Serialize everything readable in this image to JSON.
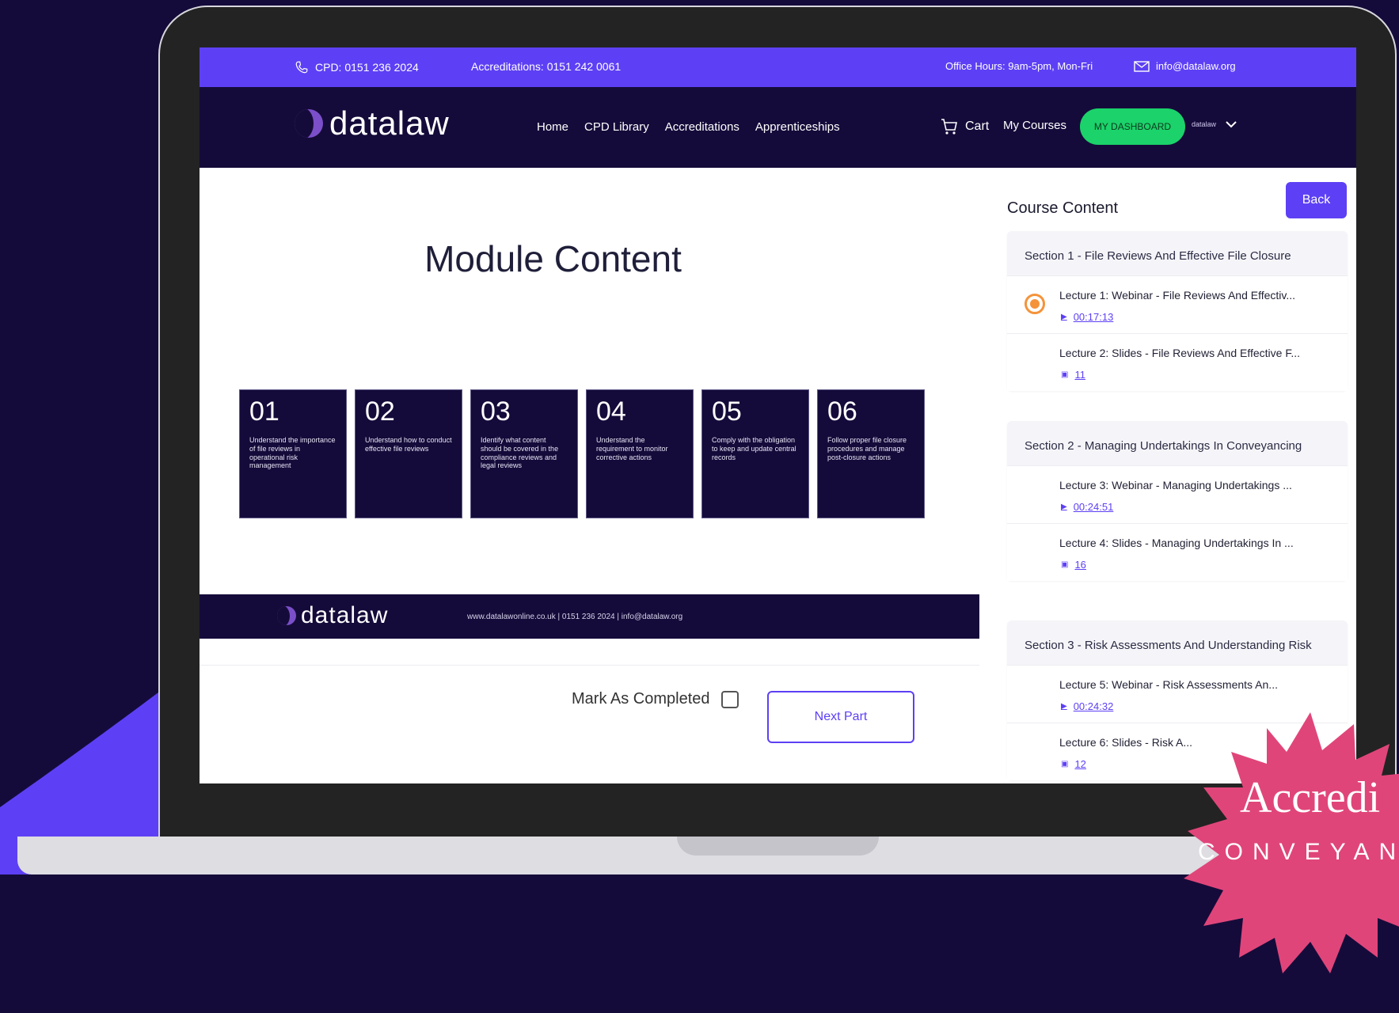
{
  "topbar": {
    "cpd": "CPD: 0151 236 2024",
    "accreditations": "Accreditations: 0151 242 0061",
    "office_hours": "Office Hours: 9am-5pm, Mon-Fri",
    "email": "info@datalaw.org"
  },
  "nav": {
    "logo": "datalaw",
    "menu": [
      "Home",
      "CPD Library",
      "Accreditations",
      "Apprenticeships"
    ],
    "cart": "Cart",
    "my_courses": "My Courses",
    "dashboard": "MY DASHBOARD",
    "user": "datalaw"
  },
  "slide": {
    "title": "Module Content",
    "boxes": [
      {
        "num": "01",
        "text": "Understand the importance of file reviews in operational risk management"
      },
      {
        "num": "02",
        "text": "Understand how to conduct effective file reviews"
      },
      {
        "num": "03",
        "text": "Identify what content should be covered in the compliance reviews and legal reviews"
      },
      {
        "num": "04",
        "text": "Understand the requirement to monitor corrective actions"
      },
      {
        "num": "05",
        "text": "Comply with the obligation to keep and update central records"
      },
      {
        "num": "06",
        "text": "Follow proper file closure procedures and manage post-closure actions"
      }
    ],
    "footer_logo": "datalaw",
    "footer_contact": "www.datalawonline.co.uk | 0151 236 2024 | info@datalaw.org"
  },
  "actions": {
    "mark_completed": "Mark As Completed",
    "next_part": "Next Part"
  },
  "sidebar": {
    "title": "Course Content",
    "back": "Back",
    "sections": [
      {
        "title": "Section 1 - File Reviews And Effective File Closure",
        "lectures": [
          {
            "title": "Lecture 1: Webinar - File Reviews And Effectiv...",
            "meta": "00:17:13",
            "icon": "play-icon",
            "active": true
          },
          {
            "title": "Lecture 2: Slides - File Reviews And Effective F...",
            "meta": "11",
            "icon": "slides-icon",
            "active": false
          }
        ]
      },
      {
        "title": "Section 2 - Managing Undertakings In Conveyancing",
        "lectures": [
          {
            "title": "Lecture 3: Webinar - Managing Undertakings ...",
            "meta": "00:24:51",
            "icon": "play-icon",
            "active": false
          },
          {
            "title": "Lecture 4: Slides - Managing Undertakings In ...",
            "meta": "16",
            "icon": "slides-icon",
            "active": false
          }
        ]
      },
      {
        "title": "Section 3 - Risk Assessments And Understanding Risk",
        "lectures": [
          {
            "title": "Lecture 5: Webinar - Risk Assessments An...",
            "meta": "00:24:32",
            "icon": "play-icon",
            "active": false
          },
          {
            "title": "Lecture 6: Slides - Risk A...",
            "meta": "12",
            "icon": "slides-icon",
            "active": false
          }
        ]
      }
    ]
  },
  "badge": {
    "line1": "Accredi",
    "line2": "CONVEYAN"
  },
  "colors": {
    "brand_purple": "#5d40f5",
    "navy": "#150b3a",
    "dashboard_green": "#1bd36a",
    "active_orange": "#f4933a",
    "badge_pink": "#e0457a"
  }
}
